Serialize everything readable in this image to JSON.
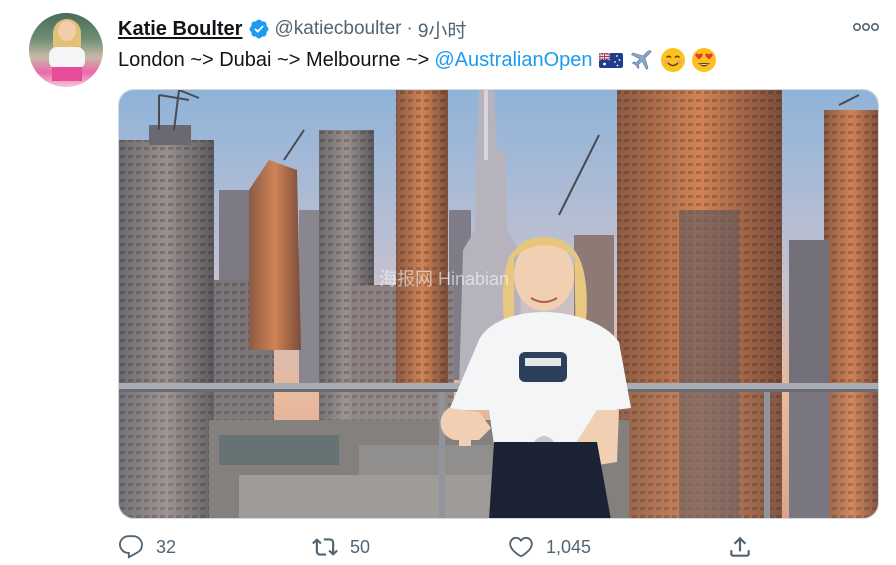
{
  "user": {
    "display_name": "Katie Boulter",
    "handle": "@katiecboulter",
    "time": "9小时",
    "verified": true
  },
  "tweet": {
    "text": "London ~> Dubai ~> Melbourne ~>",
    "mention": "@AustralianOpen",
    "emojis": [
      "australia-flag-icon",
      "airplane-icon",
      "smiling-face-icon",
      "heart-eyes-icon"
    ]
  },
  "media": {
    "watermark": "海报网 Hinabian"
  },
  "actions": {
    "reply_count": "32",
    "retweet_count": "50",
    "like_count": "1,045"
  },
  "colors": {
    "accent": "#1d9bf0",
    "secondary_text": "#536471",
    "verified": "#1d9bf0"
  }
}
